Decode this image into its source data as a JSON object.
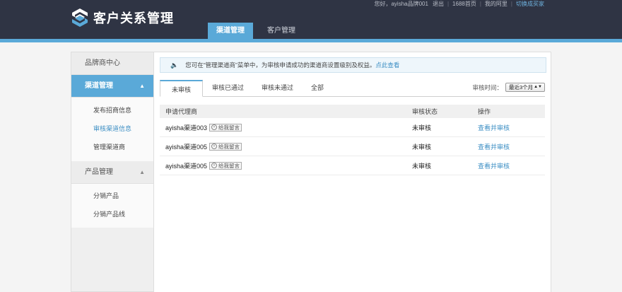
{
  "header": {
    "brand": "客户关系管理",
    "toplinks": {
      "greeting": "您好，ayisha品牌001",
      "logout": "退出",
      "homepage": "1688首页",
      "my_ali": "我的阿里",
      "switch_role": "切换成买家"
    },
    "nav": [
      {
        "label": "渠道管理",
        "active": true
      },
      {
        "label": "客户管理",
        "active": false
      }
    ]
  },
  "sidebar": {
    "sections": [
      {
        "label": "品牌商中心"
      },
      {
        "label": "渠道管理",
        "active": true,
        "chevron": "chevron-up-icon"
      },
      {
        "label": "产品管理",
        "chevron": "chevron-up-icon"
      }
    ],
    "channel_items": [
      {
        "label": "发布招商信息"
      },
      {
        "label": "审核渠道信息",
        "active": true
      },
      {
        "label": "管理渠道商"
      }
    ],
    "product_items": [
      {
        "label": "分销产品"
      },
      {
        "label": "分销产品线"
      }
    ]
  },
  "notice": {
    "text": "您可在“管理渠道商”菜单中，为审核申请成功的渠道商设置级别及权益。",
    "link": "点此查看"
  },
  "tabs": [
    {
      "label": "未审核",
      "active": true
    },
    {
      "label": "审核已通过"
    },
    {
      "label": "审核未通过"
    },
    {
      "label": "全部"
    }
  ],
  "filter": {
    "label": "审核时间：",
    "value": "最近3个月"
  },
  "table": {
    "headers": [
      "申请代理商",
      "审核状态",
      "操作"
    ],
    "message_button": "给我留言",
    "rows": [
      {
        "name": "ayisha渠道003",
        "status": "未审核",
        "action": "查看并审核"
      },
      {
        "name": "ayisha渠道005",
        "status": "未审核",
        "action": "查看并审核"
      },
      {
        "name": "ayisha渠道005",
        "status": "未审核",
        "action": "查看并审核"
      }
    ]
  },
  "colors": {
    "header_bg": "#2f3444",
    "accent": "#5aa9d8",
    "link": "#3d8fc4"
  }
}
